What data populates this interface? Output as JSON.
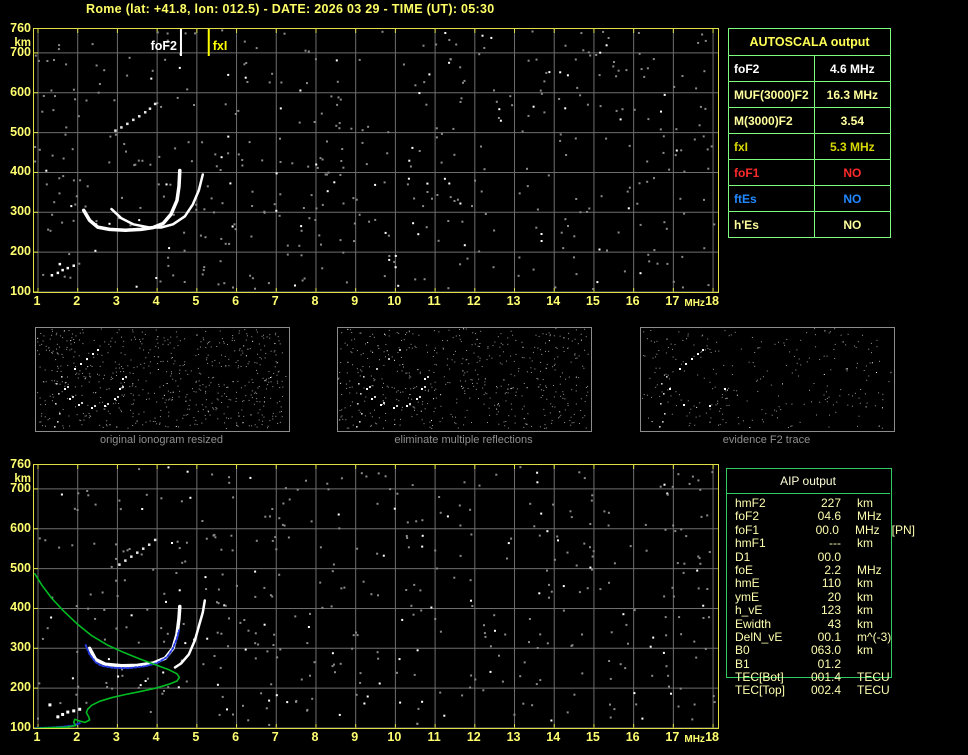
{
  "title": "Rome (lat: +41.8, lon: 012.5) - DATE: 2026 03 29 - TIME (UT): 05:30",
  "colors": {
    "background": "#000000",
    "axis_label": "#ffff70",
    "frame": "#e0e046",
    "grid": "#6e6e6e",
    "autoscala_border": "#7dff7d",
    "aip_border": "#2fcc62",
    "trace_white": "#ffffff",
    "trace_blue": "#2438e0",
    "profile_green": "#00bb22",
    "red": "#ff2a2a",
    "blue_text": "#2288ff",
    "pale_yellow": "#ffff9e",
    "dark_yellow": "#d8d800"
  },
  "autoscala_table": {
    "title": "AUTOSCALA output",
    "rows": [
      {
        "param": "foF2",
        "value": "4.6 MHz",
        "color": "#ffffff"
      },
      {
        "param": "MUF(3000)F2",
        "value": "16.3 MHz",
        "color": "#ffff9e"
      },
      {
        "param": "M(3000)F2",
        "value": "3.54",
        "color": "#ffff9e"
      },
      {
        "param": "fxI",
        "value": "5.3 MHz",
        "color": "#d8d800"
      },
      {
        "param": "foF1",
        "value": "NO",
        "color": "#ff2a2a"
      },
      {
        "param": "ftEs",
        "value": "NO",
        "color": "#2288ff"
      },
      {
        "param": "h'Es",
        "value": "NO",
        "color": "#ffff9e"
      }
    ]
  },
  "panels": [
    {
      "caption": "original ionogram resized"
    },
    {
      "caption": "eliminate multiple reflections"
    },
    {
      "caption": "evidence F2 trace"
    }
  ],
  "aip_table": {
    "title": "AIP output",
    "rows": [
      {
        "param": "hmF2",
        "value": "227",
        "unit": "km",
        "extra": ""
      },
      {
        "param": "foF2",
        "value": "04.6",
        "unit": "MHz",
        "extra": ""
      },
      {
        "param": "foF1",
        "value": "00.0",
        "unit": "MHz",
        "extra": "[PN]"
      },
      {
        "param": "hmF1",
        "value": "---",
        "unit": "km",
        "extra": ""
      },
      {
        "param": "D1",
        "value": "00.0",
        "unit": "",
        "extra": ""
      },
      {
        "param": "foE",
        "value": "2.2",
        "unit": "MHz",
        "extra": ""
      },
      {
        "param": "hmE",
        "value": "110",
        "unit": "km",
        "extra": ""
      },
      {
        "param": "ymE",
        "value": "20",
        "unit": "km",
        "extra": ""
      },
      {
        "param": "h_vE",
        "value": "123",
        "unit": "km",
        "extra": ""
      },
      {
        "param": "Ewidth",
        "value": "43",
        "unit": "km",
        "extra": ""
      },
      {
        "param": "DelN_vE",
        "value": "00.1",
        "unit": "m^(-3)",
        "extra": ""
      },
      {
        "param": "B0",
        "value": "063.0",
        "unit": "km",
        "extra": ""
      },
      {
        "param": "B1",
        "value": "01.2",
        "unit": "",
        "extra": ""
      },
      {
        "param": "TEC[Bot]",
        "value": "001.4",
        "unit": "TECU",
        "extra": ""
      },
      {
        "param": "TEC[Top]",
        "value": "002.4",
        "unit": "TECU",
        "extra": ""
      }
    ]
  },
  "chart_data": [
    {
      "name": "top_ionogram",
      "type": "scatter",
      "title": "recorded ionogram with autoscaled characteristics",
      "xlabel": "MHz",
      "ylabel": "km",
      "xlim": [
        1,
        18
      ],
      "ylim": [
        100,
        760
      ],
      "x_ticks": [
        "1",
        "2",
        "3",
        "4",
        "5",
        "6",
        "7",
        "8",
        "9",
        "10",
        "11",
        "12",
        "13",
        "14",
        "15",
        "16",
        "17",
        "18"
      ],
      "y_ticks": [
        "760",
        "700",
        "600",
        "500",
        "400",
        "300",
        "200",
        "100"
      ],
      "grid": true,
      "markers": [
        {
          "label": "foF2",
          "mhz": 4.6,
          "color": "#ffffff"
        },
        {
          "label": "fxI",
          "mhz": 5.3,
          "color": "#ffff00"
        }
      ],
      "series": [
        {
          "name": "o_mode_trace",
          "color": "#ffffff",
          "style": "line",
          "width": 3.5,
          "points": [
            [
              2.15,
              305
            ],
            [
              2.3,
              280
            ],
            [
              2.5,
              263
            ],
            [
              2.8,
              257
            ],
            [
              3.2,
              255
            ],
            [
              3.6,
              257
            ],
            [
              3.9,
              262
            ],
            [
              4.15,
              272
            ],
            [
              4.35,
              295
            ],
            [
              4.5,
              330
            ],
            [
              4.55,
              365
            ],
            [
              4.57,
              405
            ]
          ]
        },
        {
          "name": "x_mode_trace",
          "color": "#ffffff",
          "style": "line",
          "width": 2.5,
          "points": [
            [
              2.85,
              308
            ],
            [
              3.1,
              285
            ],
            [
              3.4,
              270
            ],
            [
              3.8,
              262
            ],
            [
              4.1,
              262
            ],
            [
              4.4,
              270
            ],
            [
              4.7,
              290
            ],
            [
              4.9,
              320
            ],
            [
              5.05,
              355
            ],
            [
              5.15,
              395
            ]
          ]
        },
        {
          "name": "second_hop_streak",
          "color": "#e8e8e8",
          "style": "dots",
          "width": 2.5,
          "points": [
            [
              2.95,
              505
            ],
            [
              3.1,
              513
            ],
            [
              3.25,
              522
            ],
            [
              3.4,
              532
            ],
            [
              3.55,
              541
            ],
            [
              3.7,
              551
            ],
            [
              3.82,
              560
            ],
            [
              3.95,
              572
            ]
          ]
        },
        {
          "name": "e_region_echoes",
          "color": "#ffffff",
          "style": "dots",
          "width": 2.5,
          "points": [
            [
              1.5,
              148
            ],
            [
              1.62,
              155
            ],
            [
              1.75,
              160
            ],
            [
              1.9,
              166
            ],
            [
              1.55,
              170
            ],
            [
              1.35,
              142
            ]
          ]
        }
      ]
    },
    {
      "name": "bottom_ionogram",
      "type": "scatter",
      "title": "ionogram with restored trace and electron density profile",
      "xlabel": "MHz",
      "ylabel": "km",
      "xlim": [
        1,
        18
      ],
      "ylim": [
        100,
        760
      ],
      "x_ticks": [
        "1",
        "2",
        "3",
        "4",
        "5",
        "6",
        "7",
        "8",
        "9",
        "10",
        "11",
        "12",
        "13",
        "14",
        "15",
        "16",
        "17",
        "18"
      ],
      "y_ticks": [
        "760",
        "700",
        "600",
        "500",
        "400",
        "300",
        "200",
        "100"
      ],
      "grid": true,
      "series": [
        {
          "name": "o_mode_trace",
          "color": "#ffffff",
          "style": "line",
          "width": 3.5,
          "points": [
            [
              2.3,
              300
            ],
            [
              2.45,
              272
            ],
            [
              2.7,
              260
            ],
            [
              3.1,
              256
            ],
            [
              3.5,
              257
            ],
            [
              3.9,
              263
            ],
            [
              4.2,
              275
            ],
            [
              4.4,
              300
            ],
            [
              4.5,
              335
            ],
            [
              4.55,
              375
            ],
            [
              4.57,
              405
            ]
          ]
        },
        {
          "name": "x_mode_trace",
          "color": "#ffffff",
          "style": "line",
          "width": 2.5,
          "points": [
            [
              4.45,
              252
            ],
            [
              4.6,
              262
            ],
            [
              4.8,
              285
            ],
            [
              4.95,
              320
            ],
            [
              5.05,
              355
            ],
            [
              5.15,
              390
            ],
            [
              5.2,
              420
            ]
          ]
        },
        {
          "name": "second_hop_streak",
          "color": "#e8e8e8",
          "style": "dots",
          "width": 2.5,
          "points": [
            [
              3.05,
              510
            ],
            [
              3.2,
              520
            ],
            [
              3.35,
              530
            ],
            [
              3.5,
              540
            ],
            [
              3.65,
              550
            ],
            [
              3.8,
              560
            ],
            [
              3.95,
              572
            ]
          ]
        },
        {
          "name": "es_blob",
          "color": "#ffffff",
          "style": "dots",
          "width": 3,
          "points": [
            [
              1.5,
              128
            ],
            [
              1.62,
              134
            ],
            [
              1.75,
              140
            ],
            [
              1.9,
              143
            ],
            [
              2.05,
              147
            ],
            [
              1.3,
              158
            ]
          ]
        },
        {
          "name": "restored_trace",
          "color": "#2438e0",
          "style": "dash",
          "width": 2,
          "points": [
            [
              2.2,
              308
            ],
            [
              2.3,
              285
            ],
            [
              2.45,
              265
            ],
            [
              2.6,
              256
            ],
            [
              2.9,
              251
            ],
            [
              3.3,
              250
            ],
            [
              3.7,
              255
            ],
            [
              4.0,
              263
            ],
            [
              4.25,
              278
            ],
            [
              4.4,
              300
            ],
            [
              4.5,
              325
            ],
            [
              4.55,
              345
            ]
          ]
        },
        {
          "name": "restored_es_trace",
          "color": "#2438e0",
          "style": "dash",
          "width": 2,
          "points": [
            [
              0.95,
              100
            ],
            [
              1.3,
              101
            ],
            [
              1.6,
              103
            ],
            [
              1.9,
              106
            ],
            [
              2.05,
              112
            ]
          ]
        },
        {
          "name": "electron_density_profile",
          "color": "#00bb22",
          "style": "line",
          "width": 1.6,
          "points": [
            [
              0.92,
              487
            ],
            [
              1.1,
              458
            ],
            [
              1.35,
              425
            ],
            [
              1.65,
              393
            ],
            [
              2.0,
              360
            ],
            [
              2.35,
              332
            ],
            [
              2.75,
              308
            ],
            [
              3.15,
              290
            ],
            [
              3.55,
              274
            ],
            [
              3.95,
              259
            ],
            [
              4.3,
              246
            ],
            [
              4.5,
              236
            ],
            [
              4.56,
              227
            ],
            [
              4.5,
              218
            ],
            [
              4.3,
              210
            ],
            [
              4.0,
              201
            ],
            [
              3.6,
              192
            ],
            [
              3.2,
              184
            ],
            [
              2.85,
              176
            ],
            [
              2.55,
              167
            ],
            [
              2.35,
              157
            ],
            [
              2.25,
              147
            ],
            [
              2.22,
              138
            ],
            [
              2.28,
              128
            ],
            [
              2.3,
              120
            ],
            [
              2.18,
              114
            ],
            [
              2.02,
              118
            ],
            [
              1.93,
              122
            ],
            [
              1.9,
              114
            ],
            [
              1.95,
              106
            ],
            [
              1.7,
              102
            ],
            [
              1.4,
              101
            ],
            [
              1.1,
              100
            ],
            [
              0.95,
              99
            ]
          ]
        }
      ]
    },
    {
      "name": "mini_panels_shared_traces",
      "type": "scatter",
      "arc": [
        [
          28,
          60
        ],
        [
          33,
          70
        ],
        [
          42,
          76
        ],
        [
          55,
          79
        ],
        [
          68,
          77
        ],
        [
          78,
          70
        ],
        [
          83,
          60
        ],
        [
          86,
          50
        ]
      ],
      "streak": [
        [
          38,
          40
        ],
        [
          44,
          35
        ],
        [
          50,
          30
        ],
        [
          56,
          25
        ],
        [
          61,
          21
        ]
      ],
      "scatter_col": [
        [
          20,
          55
        ],
        [
          22,
          65
        ],
        [
          19,
          75
        ],
        [
          23,
          85
        ],
        [
          21,
          93
        ],
        [
          25,
          48
        ],
        [
          18,
          98
        ]
      ]
    }
  ]
}
